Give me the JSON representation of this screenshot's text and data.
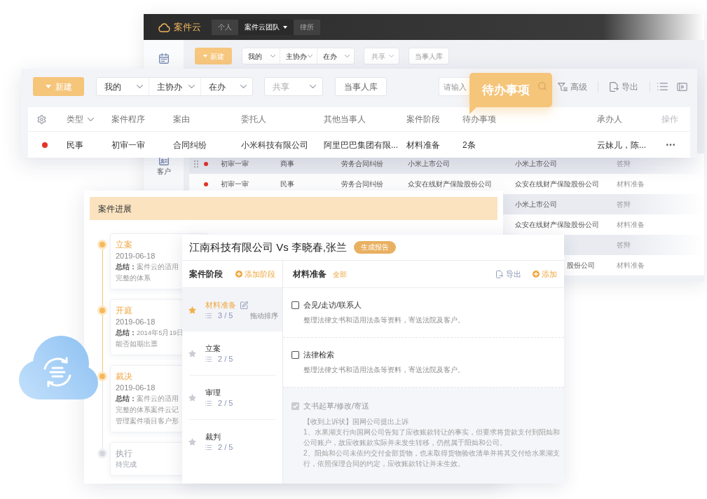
{
  "back_window": {
    "logo": "案件云",
    "tabs": [
      {
        "label": "个人",
        "selected": false,
        "dropdown": false
      },
      {
        "label": "案件云团队",
        "selected": true,
        "dropdown": true
      },
      {
        "label": "律所",
        "selected": false,
        "dropdown": false
      }
    ],
    "sidebar": {
      "items": [
        {
          "label": "客户"
        }
      ]
    },
    "toolbar": {
      "new_button": "新建",
      "filters": [
        "我的",
        "主协办",
        "在办"
      ],
      "share": {
        "label": "共享",
        "disabled": true
      },
      "party_library": "当事人库"
    },
    "rows": [
      {
        "drag_handle": true,
        "color": "#e6332a",
        "column_1": "初审一审",
        "column_2": "商事",
        "column_3": "劳务合同纠纷",
        "column_4": "小米上市公司",
        "column_5": "小米上市公司",
        "column_6": "答辩"
      },
      {
        "drag_handle": false,
        "color": "#e6332a",
        "column_1": "初审一审",
        "column_2": "民事",
        "column_3": "劳务合同纠纷",
        "column_4": "众安在线财产保险股份公司",
        "column_5": "众安在线财产保险股份公司",
        "column_6": "材料准备"
      },
      {
        "column_5": "小米上市公司",
        "column_6": "答辩"
      },
      {
        "column_5": "众安在线财产保险股份公司",
        "column_6": "材料准备"
      },
      {
        "column_6": "答辩"
      },
      {
        "column_5": "股份公司",
        "column_5_cut": true,
        "column_6": "材料准备"
      }
    ]
  },
  "case_list": {
    "toolbar": {
      "new_button": "新建",
      "filters": [
        "我的",
        "主协办",
        "在办"
      ],
      "share": {
        "label": "共享",
        "disabled": true
      },
      "party_library": "当事人库",
      "search": {
        "placeholder": "请输入"
      },
      "advanced": "高级",
      "export": "导出"
    },
    "columns": [
      {
        "label": "类型",
        "sortable": true
      },
      {
        "label": "案件程序",
        "sortable": false
      },
      {
        "label": "案由",
        "sortable": false
      },
      {
        "label": "委托人",
        "sortable": false
      },
      {
        "label": "其他当事人",
        "sortable": false
      },
      {
        "label": "案件阶段",
        "sortable": false
      },
      {
        "label": "待办事项",
        "sortable": false
      },
      {
        "label": "承办人",
        "sortable": false
      },
      {
        "label": "操作",
        "sortable": false
      }
    ],
    "rows": [
      {
        "color": "#e6332a",
        "cells": [
          "民事",
          "初审一审",
          "合同纠纷",
          "小米科技有限公司",
          "阿里巴巴集团有限...",
          "材料准备",
          "2条",
          "云妹儿，陈..."
        ]
      }
    ]
  },
  "callout": {
    "text": "待办事项"
  },
  "case_progress": {
    "title": "案件进展",
    "events": [
      {
        "name": "立案",
        "date": "2019-06-18",
        "summary": [
          "**总结：**案件云的适用",
          "完整的体系"
        ],
        "done": true
      },
      {
        "name": "开庭",
        "date": "2019-06-18",
        "summary": [
          "**总结：**2014年5月19日",
          "能否如期出票"
        ],
        "done": true
      },
      {
        "name": "裁决",
        "date": "2019-06-18",
        "summary": [
          "**总结：**案件云的适用",
          "完整的体系案件云记",
          "管理案件项目客户形"
        ],
        "done": true
      },
      {
        "name": "执行",
        "status": "待完成",
        "done": false
      }
    ]
  },
  "case_detail": {
    "title": "江南科技有限公司 Vs 李晓春,张兰",
    "report_button": "生成报告",
    "stages_header": "案件阶段",
    "add_stage": "添加阶段",
    "stages": [
      {
        "name": "材料准备",
        "progress": "3 / 5",
        "sort_hint": "拖动排序",
        "selected": true
      },
      {
        "name": "立案",
        "progress": "2 / 5",
        "selected": false
      },
      {
        "name": "审理",
        "progress": "2 / 5",
        "selected": false
      },
      {
        "name": "裁判",
        "progress": "2 / 5",
        "selected": false
      }
    ],
    "tasks_header": "材料准备",
    "filter": "全部",
    "export": "导出",
    "add": "添加",
    "tasks": [
      {
        "title": "会见/走访/联系人",
        "checked": false,
        "description": "整理法律文书和适用法条等资料，寄送法院及客户。"
      },
      {
        "title": "法律检索",
        "checked": false,
        "description": "整理法律文书和适用法条等资料，寄送法院及客户。"
      },
      {
        "title": "文书起草/修改/寄送",
        "checked": true,
        "notes": [
          "【收到上诉状】国网公司提出上诉",
          "1、水果湖支行向国网公司告知了应收账款转让的事实，但要求将货款支付到阳灿和公司账户，故应收账款实际并未发生转移，仍然属于阳灿和公司。",
          "2、阳灿和公司未依约交付全部货物，也未取得货物验收清单并将其交付给水果湖支行，依照保理合同的约定，应收账款转让并未生效。"
        ]
      }
    ]
  }
}
